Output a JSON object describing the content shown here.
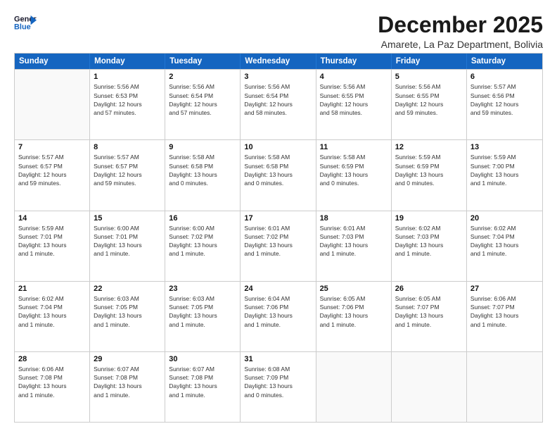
{
  "header": {
    "logo_line1": "General",
    "logo_line2": "Blue",
    "month_title": "December 2025",
    "location": "Amarete, La Paz Department, Bolivia"
  },
  "weekdays": [
    "Sunday",
    "Monday",
    "Tuesday",
    "Wednesday",
    "Thursday",
    "Friday",
    "Saturday"
  ],
  "weeks": [
    [
      {
        "day": "",
        "info": ""
      },
      {
        "day": "1",
        "info": "Sunrise: 5:56 AM\nSunset: 6:53 PM\nDaylight: 12 hours\nand 57 minutes."
      },
      {
        "day": "2",
        "info": "Sunrise: 5:56 AM\nSunset: 6:54 PM\nDaylight: 12 hours\nand 57 minutes."
      },
      {
        "day": "3",
        "info": "Sunrise: 5:56 AM\nSunset: 6:54 PM\nDaylight: 12 hours\nand 58 minutes."
      },
      {
        "day": "4",
        "info": "Sunrise: 5:56 AM\nSunset: 6:55 PM\nDaylight: 12 hours\nand 58 minutes."
      },
      {
        "day": "5",
        "info": "Sunrise: 5:56 AM\nSunset: 6:55 PM\nDaylight: 12 hours\nand 59 minutes."
      },
      {
        "day": "6",
        "info": "Sunrise: 5:57 AM\nSunset: 6:56 PM\nDaylight: 12 hours\nand 59 minutes."
      }
    ],
    [
      {
        "day": "7",
        "info": "Sunrise: 5:57 AM\nSunset: 6:57 PM\nDaylight: 12 hours\nand 59 minutes."
      },
      {
        "day": "8",
        "info": "Sunrise: 5:57 AM\nSunset: 6:57 PM\nDaylight: 12 hours\nand 59 minutes."
      },
      {
        "day": "9",
        "info": "Sunrise: 5:58 AM\nSunset: 6:58 PM\nDaylight: 13 hours\nand 0 minutes."
      },
      {
        "day": "10",
        "info": "Sunrise: 5:58 AM\nSunset: 6:58 PM\nDaylight: 13 hours\nand 0 minutes."
      },
      {
        "day": "11",
        "info": "Sunrise: 5:58 AM\nSunset: 6:59 PM\nDaylight: 13 hours\nand 0 minutes."
      },
      {
        "day": "12",
        "info": "Sunrise: 5:59 AM\nSunset: 6:59 PM\nDaylight: 13 hours\nand 0 minutes."
      },
      {
        "day": "13",
        "info": "Sunrise: 5:59 AM\nSunset: 7:00 PM\nDaylight: 13 hours\nand 1 minute."
      }
    ],
    [
      {
        "day": "14",
        "info": "Sunrise: 5:59 AM\nSunset: 7:01 PM\nDaylight: 13 hours\nand 1 minute."
      },
      {
        "day": "15",
        "info": "Sunrise: 6:00 AM\nSunset: 7:01 PM\nDaylight: 13 hours\nand 1 minute."
      },
      {
        "day": "16",
        "info": "Sunrise: 6:00 AM\nSunset: 7:02 PM\nDaylight: 13 hours\nand 1 minute."
      },
      {
        "day": "17",
        "info": "Sunrise: 6:01 AM\nSunset: 7:02 PM\nDaylight: 13 hours\nand 1 minute."
      },
      {
        "day": "18",
        "info": "Sunrise: 6:01 AM\nSunset: 7:03 PM\nDaylight: 13 hours\nand 1 minute."
      },
      {
        "day": "19",
        "info": "Sunrise: 6:02 AM\nSunset: 7:03 PM\nDaylight: 13 hours\nand 1 minute."
      },
      {
        "day": "20",
        "info": "Sunrise: 6:02 AM\nSunset: 7:04 PM\nDaylight: 13 hours\nand 1 minute."
      }
    ],
    [
      {
        "day": "21",
        "info": "Sunrise: 6:02 AM\nSunset: 7:04 PM\nDaylight: 13 hours\nand 1 minute."
      },
      {
        "day": "22",
        "info": "Sunrise: 6:03 AM\nSunset: 7:05 PM\nDaylight: 13 hours\nand 1 minute."
      },
      {
        "day": "23",
        "info": "Sunrise: 6:03 AM\nSunset: 7:05 PM\nDaylight: 13 hours\nand 1 minute."
      },
      {
        "day": "24",
        "info": "Sunrise: 6:04 AM\nSunset: 7:06 PM\nDaylight: 13 hours\nand 1 minute."
      },
      {
        "day": "25",
        "info": "Sunrise: 6:05 AM\nSunset: 7:06 PM\nDaylight: 13 hours\nand 1 minute."
      },
      {
        "day": "26",
        "info": "Sunrise: 6:05 AM\nSunset: 7:07 PM\nDaylight: 13 hours\nand 1 minute."
      },
      {
        "day": "27",
        "info": "Sunrise: 6:06 AM\nSunset: 7:07 PM\nDaylight: 13 hours\nand 1 minute."
      }
    ],
    [
      {
        "day": "28",
        "info": "Sunrise: 6:06 AM\nSunset: 7:08 PM\nDaylight: 13 hours\nand 1 minute."
      },
      {
        "day": "29",
        "info": "Sunrise: 6:07 AM\nSunset: 7:08 PM\nDaylight: 13 hours\nand 1 minute."
      },
      {
        "day": "30",
        "info": "Sunrise: 6:07 AM\nSunset: 7:08 PM\nDaylight: 13 hours\nand 1 minute."
      },
      {
        "day": "31",
        "info": "Sunrise: 6:08 AM\nSunset: 7:09 PM\nDaylight: 13 hours\nand 0 minutes."
      },
      {
        "day": "",
        "info": ""
      },
      {
        "day": "",
        "info": ""
      },
      {
        "day": "",
        "info": ""
      }
    ]
  ]
}
